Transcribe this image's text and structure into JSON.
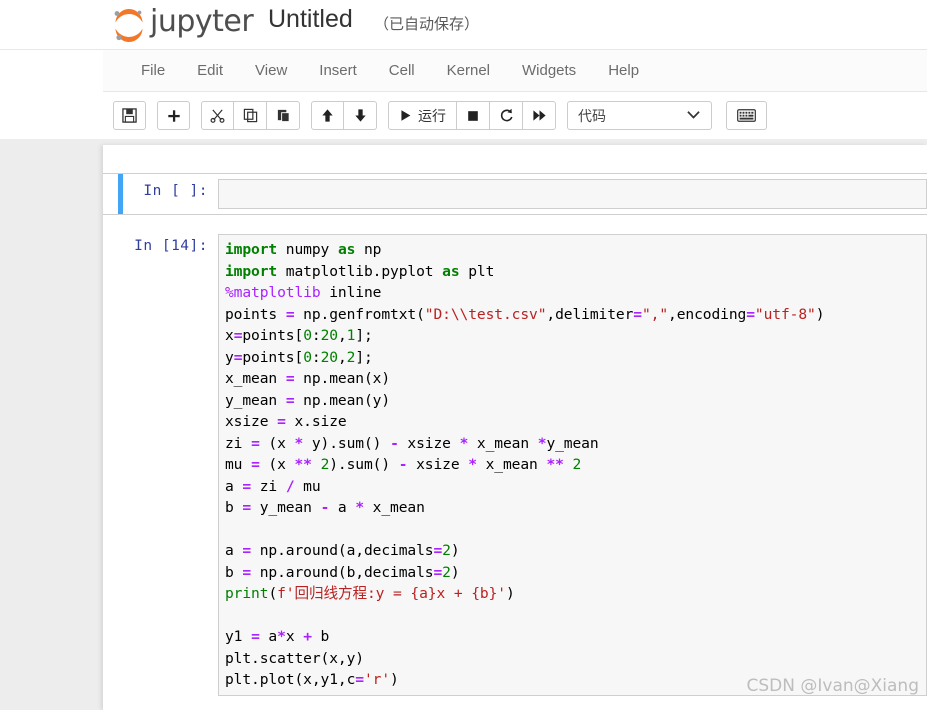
{
  "header": {
    "brand": "jupyter",
    "logo_icon": "jupyter-logo-icon",
    "title": "Untitled",
    "autosave_status": "（已自动保存）",
    "brand_color": "#f37726"
  },
  "menubar": {
    "items": [
      {
        "label": "File"
      },
      {
        "label": "Edit"
      },
      {
        "label": "View"
      },
      {
        "label": "Insert"
      },
      {
        "label": "Cell"
      },
      {
        "label": "Kernel"
      },
      {
        "label": "Widgets"
      },
      {
        "label": "Help"
      }
    ]
  },
  "toolbar": {
    "save_icon": "save-floppy-icon",
    "add_icon": "plus-icon",
    "cut_icon": "scissors-icon",
    "copy_icon": "copy-icon",
    "paste_icon": "paste-icon",
    "move_up_icon": "arrow-up-icon",
    "move_down_icon": "arrow-down-icon",
    "run_icon": "play-triangle-icon",
    "run_label": "运行",
    "stop_icon": "stop-square-icon",
    "restart_icon": "restart-circular-arrow-icon",
    "restart_run_all_icon": "fast-forward-icon",
    "cell_type_value": "代码",
    "cell_type_chevron_icon": "chevron-down-icon",
    "command_palette_icon": "keyboard-icon"
  },
  "cells": [
    {
      "prompt": "In  [ ]:",
      "selected": true,
      "empty": true,
      "code": ""
    },
    {
      "prompt": "In  [14]:",
      "selected": false,
      "empty": false,
      "code_lines": [
        "import numpy as np",
        "import matplotlib.pyplot as plt",
        "%matplotlib inline",
        "points = np.genfromtxt(\"D:\\\\test.csv\",delimiter=\",\",encoding=\"utf-8\")",
        "x=points[0:20,1];",
        "y=points[0:20,2];",
        "x_mean = np.mean(x)",
        "y_mean = np.mean(y)",
        "xsize = x.size",
        "zi = (x * y).sum() - xsize * x_mean *y_mean",
        "mu = (x ** 2).sum() - xsize * x_mean ** 2",
        "a = zi / mu",
        "b = y_mean - a * x_mean",
        "",
        "a = np.around(a,decimals=2)",
        "b = np.around(b,decimals=2)",
        "print(f'回归线方程:y = {a}x + {b}')",
        "",
        "y1 = a*x + b",
        "plt.scatter(x,y)",
        "plt.plot(x,y1,c='r')"
      ]
    }
  ],
  "watermark": {
    "text": "CSDN @Ivan@Xiang"
  }
}
